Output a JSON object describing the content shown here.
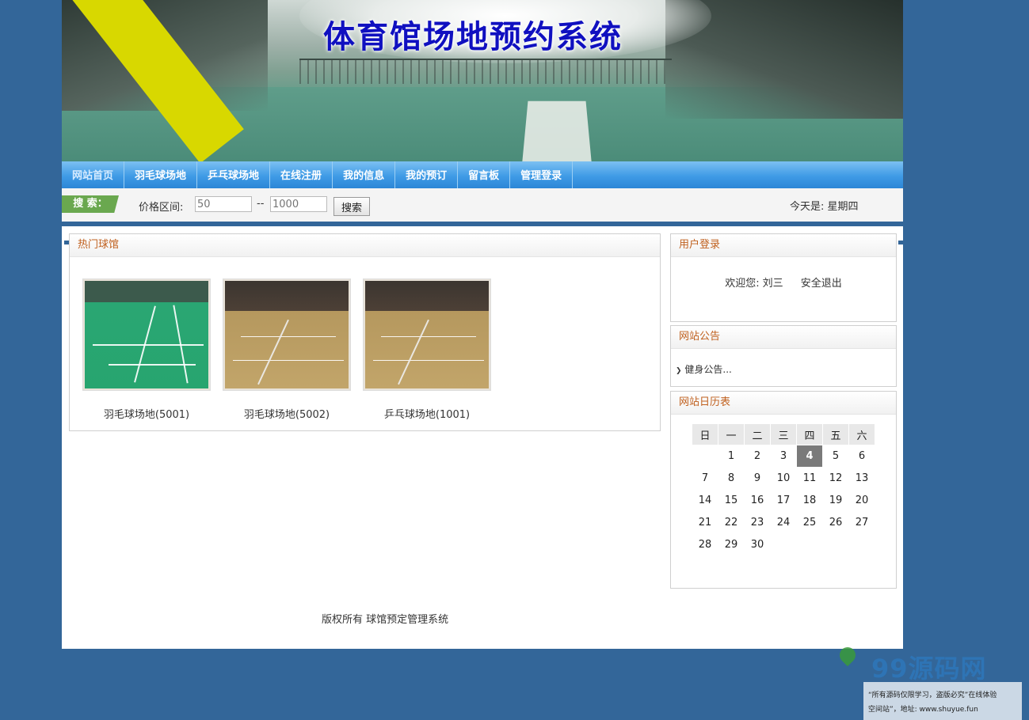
{
  "banner": {
    "title": "体育馆场地预约系统"
  },
  "nav": {
    "items": [
      {
        "label": "网站首页"
      },
      {
        "label": "羽毛球场地"
      },
      {
        "label": "乒乓球场地"
      },
      {
        "label": "在线注册"
      },
      {
        "label": "我的信息"
      },
      {
        "label": "我的预订"
      },
      {
        "label": "留言板"
      },
      {
        "label": "管理登录"
      }
    ]
  },
  "search": {
    "tag": "搜 索：",
    "price_label": "价格区间:",
    "min_placeholder": "50",
    "max_placeholder": "1000",
    "dash": "--",
    "button": "搜索",
    "today": "今天是:   星期四"
  },
  "hot": {
    "title": "热门球馆",
    "courts": [
      {
        "name": "羽毛球场地(5001)",
        "style": "green"
      },
      {
        "name": "羽毛球场地(5002)",
        "style": "tan"
      },
      {
        "name": "乒乓球场地(1001)",
        "style": "tan"
      }
    ]
  },
  "login": {
    "title": "用户登录",
    "welcome": "欢迎您:",
    "user": "刘三",
    "logout": "安全退出"
  },
  "notice": {
    "title": "网站公告",
    "item": "健身公告..."
  },
  "calendar": {
    "title": "网站日历表",
    "weekdays": [
      "日",
      "一",
      "二",
      "三",
      "四",
      "五",
      "六"
    ],
    "weeks": [
      [
        "",
        "1",
        "2",
        "3",
        "4",
        "5",
        "6"
      ],
      [
        "7",
        "8",
        "9",
        "10",
        "11",
        "12",
        "13"
      ],
      [
        "14",
        "15",
        "16",
        "17",
        "18",
        "19",
        "20"
      ],
      [
        "21",
        "22",
        "23",
        "24",
        "25",
        "26",
        "27"
      ],
      [
        "28",
        "29",
        "30",
        "",
        "",
        "",
        ""
      ]
    ],
    "today": "4"
  },
  "footer": {
    "text": "版权所有 球馆预定管理系统"
  },
  "watermark": {
    "logo": "99源码网",
    "line1": "“所有源码仅限学习，盗版必究”在线体验",
    "line2": "空间站”，地址: www.shuyue.fun"
  },
  "colors": {
    "page_bg": "#336699",
    "nav_blue": "#3f9be6",
    "panel_title": "#c0601e",
    "title_blue": "#1010c0"
  }
}
